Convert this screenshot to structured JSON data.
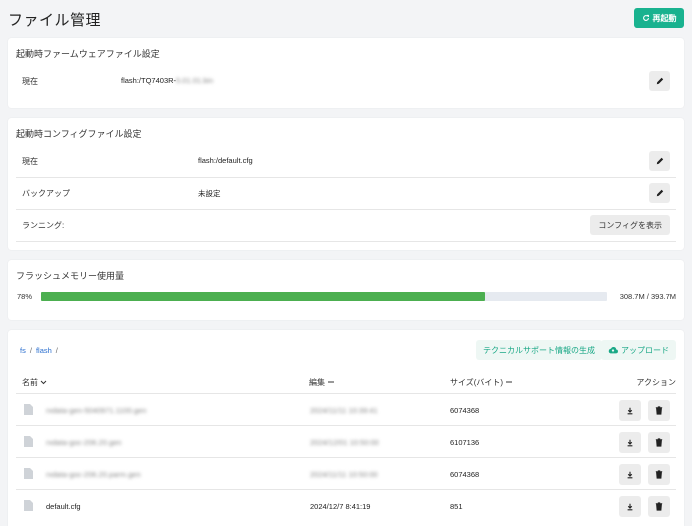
{
  "header": {
    "title": "ファイル管理",
    "restart_label": "再起動"
  },
  "firmware": {
    "title": "起動時ファームウェアファイル設定",
    "current_label": "現在",
    "current_value": "flash:/TQ7403R-",
    "current_value_hidden": "5.01.01.bin"
  },
  "config": {
    "title": "起動時コンフィグファイル設定",
    "rows": [
      {
        "label": "現在",
        "value": "flash:/default.cfg"
      },
      {
        "label": "バックアップ",
        "value": "未設定"
      },
      {
        "label": "ランニング:",
        "button": "コンフィグを表示"
      }
    ]
  },
  "flash": {
    "title": "フラッシュメモリー使用量",
    "percent_label": "78%",
    "used_fraction": 0.784,
    "usage_label": "308.7M / 393.7M",
    "bar_color": "#4caf50"
  },
  "files": {
    "breadcrumb": [
      "fs",
      "flash"
    ],
    "separator": "/",
    "tech_support_label": "テクニカルサポート情報の生成",
    "upload_label": "アップロード",
    "columns": {
      "name": "名前",
      "modified": "編集",
      "size": "サイズ(バイト)",
      "actions": "アクション"
    },
    "rows": [
      {
        "name": "rxdata-gen-5040971.1100.gen",
        "date": "2024/11/11 10:39:41",
        "size": "6074368",
        "blurred": true
      },
      {
        "name": "rxdata-goc-206.20.gen",
        "date": "2024/12/01 10:50:00",
        "size": "6107136",
        "blurred": true
      },
      {
        "name": "rxdata-goc-206.20.parm.gen",
        "date": "2024/11/11 10:50:00",
        "size": "6074368",
        "blurred": true
      },
      {
        "name": "default.cfg",
        "date": "2024/12/7 8:41:19",
        "size": "851",
        "blurred": false
      }
    ]
  },
  "colors": {
    "accent": "#19b28f",
    "link": "#2b6fcf"
  }
}
